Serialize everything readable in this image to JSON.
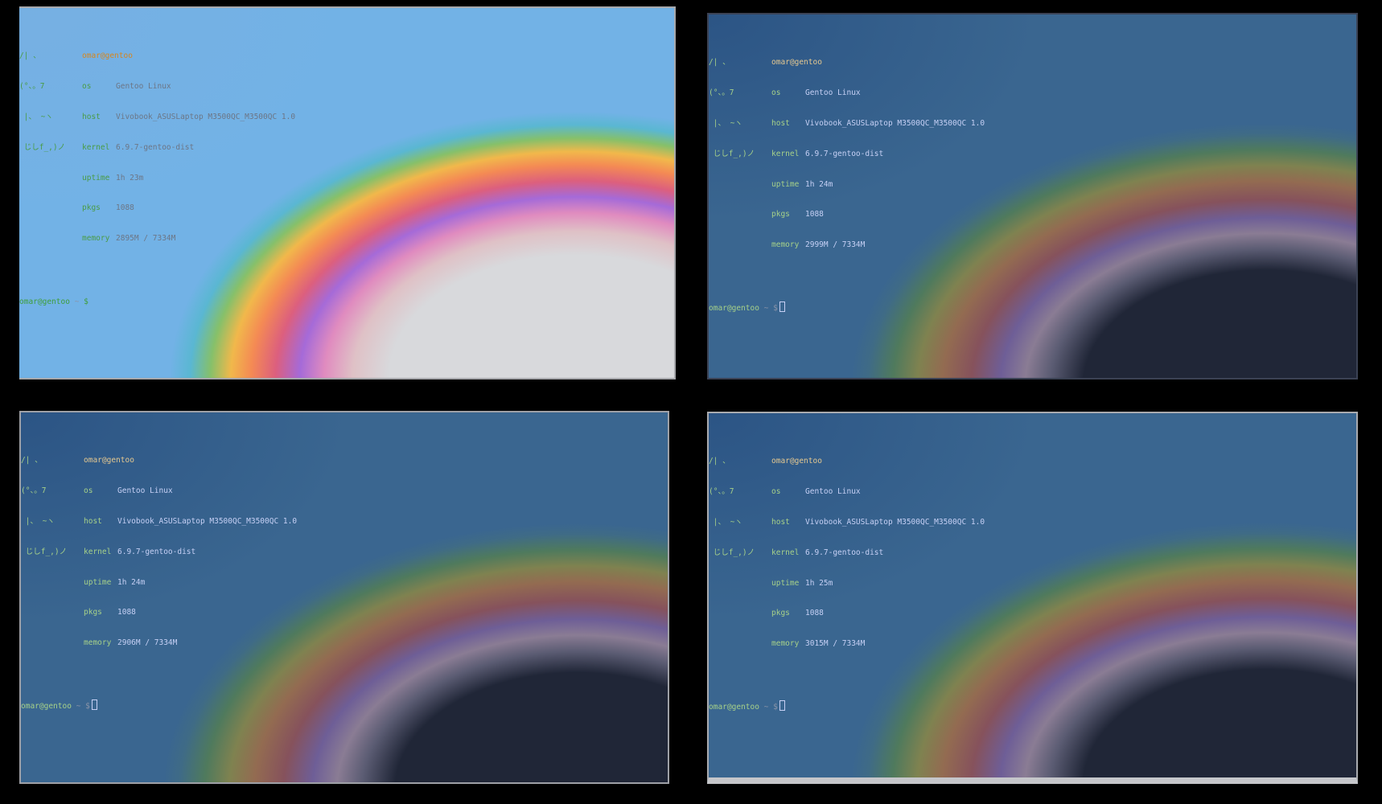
{
  "terminals": [
    {
      "theme": "light",
      "logo": [
        "/| 、",
        "(°、。7",
        " |、 ~ヽ",
        " じしf_,)ノ"
      ],
      "user_host": "omar@gentoo",
      "info": [
        {
          "key": "os",
          "value": "Gentoo Linux"
        },
        {
          "key": "host",
          "value": "Vivobook_ASUSLaptop M3500QC_M3500QC 1.0"
        },
        {
          "key": "kernel",
          "value": "6.9.7-gentoo-dist"
        },
        {
          "key": "uptime",
          "value": "1h 23m"
        },
        {
          "key": "pkgs",
          "value": "1088"
        },
        {
          "key": "memory",
          "value": "2895M / 7334M"
        }
      ],
      "prompt": {
        "user": "omar@gentoo",
        "path": "~",
        "symbol": "$"
      }
    },
    {
      "theme": "dark",
      "logo": [
        "/| 、",
        "(°、。7",
        " |、 ~ヽ",
        " じしf_,)ノ"
      ],
      "user_host": "omar@gentoo",
      "info": [
        {
          "key": "os",
          "value": "Gentoo Linux"
        },
        {
          "key": "host",
          "value": "Vivobook_ASUSLaptop M3500QC_M3500QC 1.0"
        },
        {
          "key": "kernel",
          "value": "6.9.7-gentoo-dist"
        },
        {
          "key": "uptime",
          "value": "1h 24m"
        },
        {
          "key": "pkgs",
          "value": "1088"
        },
        {
          "key": "memory",
          "value": "2999M / 7334M"
        }
      ],
      "prompt": {
        "user": "omar@gentoo",
        "path": "~",
        "symbol": "$"
      }
    },
    {
      "theme": "dark",
      "logo": [
        "/| 、",
        "(°、。7",
        " |、 ~ヽ",
        " じしf_,)ノ"
      ],
      "user_host": "omar@gentoo",
      "info": [
        {
          "key": "os",
          "value": "Gentoo Linux"
        },
        {
          "key": "host",
          "value": "Vivobook_ASUSLaptop M3500QC_M3500QC 1.0"
        },
        {
          "key": "kernel",
          "value": "6.9.7-gentoo-dist"
        },
        {
          "key": "uptime",
          "value": "1h 24m"
        },
        {
          "key": "pkgs",
          "value": "1088"
        },
        {
          "key": "memory",
          "value": "2906M / 7334M"
        }
      ],
      "prompt": {
        "user": "omar@gentoo",
        "path": "~",
        "symbol": "$"
      }
    },
    {
      "theme": "dark",
      "logo": [
        "/| 、",
        "(°、。7",
        " |、 ~ヽ",
        " じしf_,)ノ"
      ],
      "user_host": "omar@gentoo",
      "info": [
        {
          "key": "os",
          "value": "Gentoo Linux"
        },
        {
          "key": "host",
          "value": "Vivobook_ASUSLaptop M3500QC_M3500QC 1.0"
        },
        {
          "key": "kernel",
          "value": "6.9.7-gentoo-dist"
        },
        {
          "key": "uptime",
          "value": "1h 25m"
        },
        {
          "key": "pkgs",
          "value": "1088"
        },
        {
          "key": "memory",
          "value": "3015M / 7334M"
        }
      ],
      "prompt": {
        "user": "omar@gentoo",
        "path": "~",
        "symbol": "$"
      }
    }
  ],
  "colors": {
    "background": "#000000",
    "dark_wallpaper_core": "#202637",
    "light_wallpaper_core": "#d8d9dc",
    "key_green": "#a6d189",
    "user_host_yellow": "#e5c890",
    "value_text": "#c6d0f5"
  }
}
